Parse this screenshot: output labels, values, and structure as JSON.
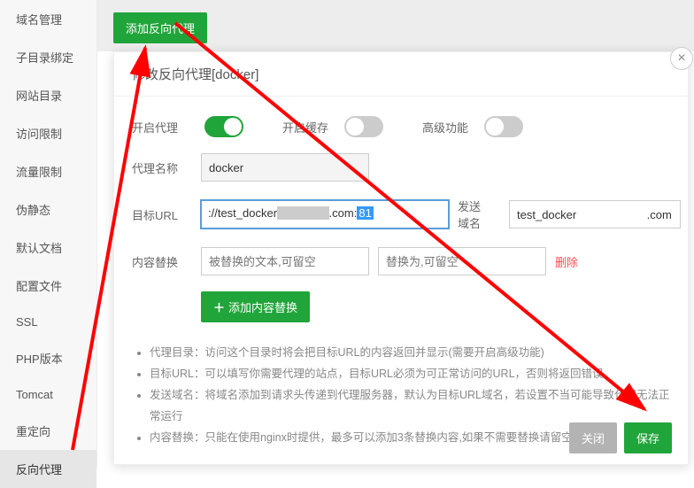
{
  "sidebar": {
    "items": [
      {
        "label": "域名管理"
      },
      {
        "label": "子目录绑定"
      },
      {
        "label": "网站目录"
      },
      {
        "label": "访问限制"
      },
      {
        "label": "流量限制"
      },
      {
        "label": "伪静态"
      },
      {
        "label": "默认文档"
      },
      {
        "label": "配置文件"
      },
      {
        "label": "SSL"
      },
      {
        "label": "PHP版本"
      },
      {
        "label": "Tomcat"
      },
      {
        "label": "重定向"
      },
      {
        "label": "反向代理"
      }
    ],
    "active_index": 12
  },
  "topbar": {
    "add_proxy_label": "添加反向代理"
  },
  "modal": {
    "title": "修改反向代理[docker]",
    "toggle_proxy_label": "开启代理",
    "toggle_proxy_on": true,
    "toggle_cache_label": "开启缓存",
    "toggle_cache_on": false,
    "toggle_adv_label": "高级功能",
    "toggle_adv_on": false,
    "name_label": "代理名称",
    "name_value": "docker",
    "url_label": "目标URL",
    "url_value": "://test_docker",
    "url_suffix": ".com:",
    "url_port": "81",
    "send_domain_label": "发送域名",
    "send_domain_value": "test_docker                      .com",
    "replace_label": "内容替换",
    "replace_from_placeholder": "被替换的文本,可留空",
    "replace_to_placeholder": "替换为,可留空",
    "replace_delete": "删除",
    "add_replace_label": "添加内容替换",
    "help": [
      "代理目录：访问这个目录时将会把目标URL的内容返回并显示(需要开启高级功能)",
      "目标URL：可以填写你需要代理的站点，目标URL必须为可正常访问的URL，否则将返回错误",
      "发送域名：将域名添加到请求头传递到代理服务器，默认为目标URL域名，若设置不当可能导致代理无法正常运行",
      "内容替换：只能在使用nginx时提供，最多可以添加3条替换内容,如果不需要替换请留空"
    ],
    "close_label": "关闭",
    "save_label": "保存"
  }
}
